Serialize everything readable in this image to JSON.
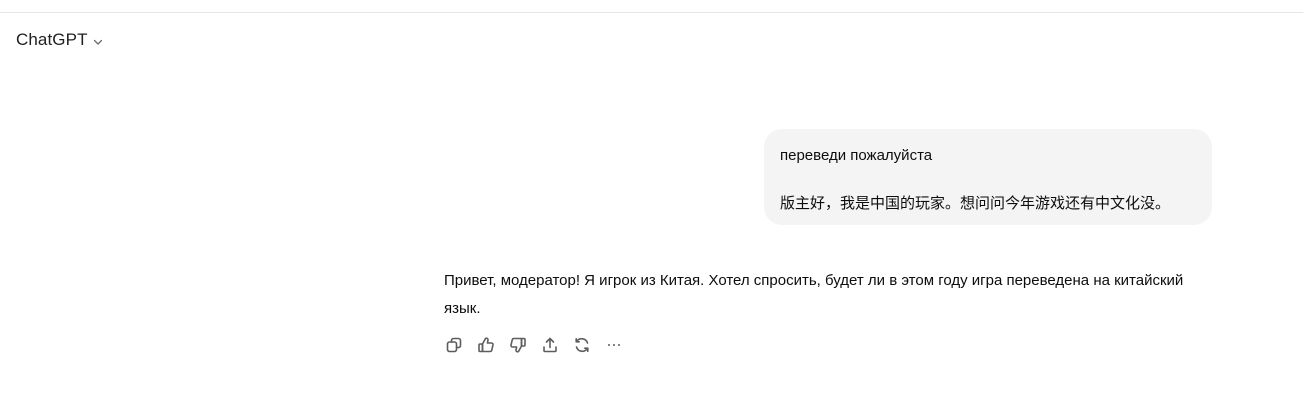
{
  "header": {
    "model_name": "ChatGPT",
    "dropdown_icon": "chevron-down-icon"
  },
  "messages": [
    {
      "role": "user",
      "lines": [
        "переведи пожалуйста",
        "版主好，我是中国的玩家。想问问今年游戏还有中文化没。"
      ]
    },
    {
      "role": "assistant",
      "text": "Привет, модератор! Я игрок из Китая. Хотел спросить, будет ли в этом году игра переведена на китайский язык."
    }
  ],
  "actions": [
    {
      "icon": "copy-icon"
    },
    {
      "icon": "thumbs-up-icon"
    },
    {
      "icon": "thumbs-down-icon"
    },
    {
      "icon": "share-icon"
    },
    {
      "icon": "regenerate-icon"
    },
    {
      "icon": "more-icon"
    }
  ],
  "colors": {
    "bubble_bg": "#f4f4f4",
    "icon_stroke": "#5d5d5d",
    "divider": "#e6e6e6"
  }
}
